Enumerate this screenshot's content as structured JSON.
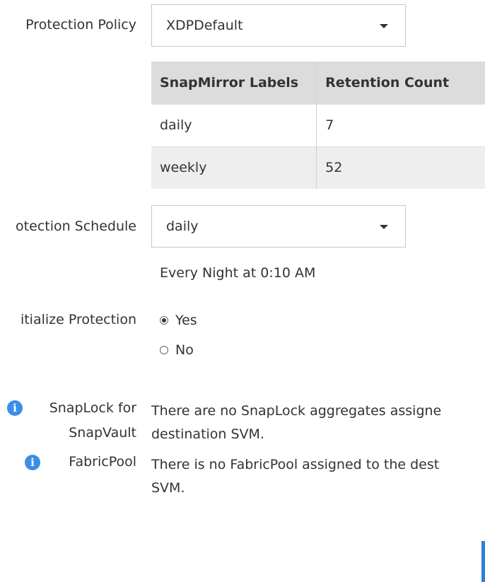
{
  "protection_policy": {
    "label": "Protection Policy",
    "selected": "XDPDefault"
  },
  "retention_table": {
    "headers": [
      "SnapMirror Labels",
      "Retention Count"
    ],
    "rows": [
      {
        "label": "daily",
        "count": "7"
      },
      {
        "label": "weekly",
        "count": "52"
      }
    ]
  },
  "protection_schedule": {
    "label": "otection Schedule",
    "selected": "daily",
    "description": "Every Night at 0:10 AM"
  },
  "initialize_protection": {
    "label": "itialize Protection",
    "options": [
      "Yes",
      "No"
    ],
    "selected": "Yes"
  },
  "snaplock": {
    "label_line1": "SnapLock for",
    "label_line2": "SnapVault",
    "message_line1": "There are no SnapLock aggregates assigne",
    "message_line2": "destination SVM."
  },
  "fabricpool": {
    "label": "FabricPool",
    "message_line1": "There is no FabricPool assigned to the dest",
    "message_line2": "SVM."
  },
  "icons": {
    "info": "i"
  },
  "colors": {
    "info_icon": "#3a8ee6",
    "header_bg": "#dcdcdc",
    "alt_row_bg": "#eeeeee",
    "accent": "#2f80d6"
  }
}
